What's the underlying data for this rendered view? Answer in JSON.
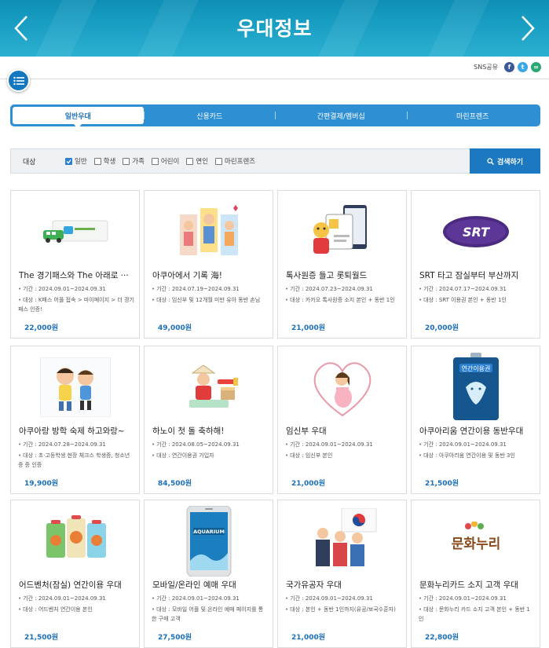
{
  "header": {
    "title": "우대정보"
  },
  "sns": {
    "label": "SNS공유"
  },
  "tabs": [
    {
      "label": "일반우대",
      "active": true
    },
    {
      "label": "신용카드",
      "active": false
    },
    {
      "label": "간편결제/멤버십",
      "active": false
    },
    {
      "label": "마린프렌즈",
      "active": false
    }
  ],
  "filter": {
    "label": "대상",
    "options": [
      {
        "label": "일반",
        "checked": true
      },
      {
        "label": "학생",
        "checked": false
      },
      {
        "label": "가족",
        "checked": false
      },
      {
        "label": "어린이",
        "checked": false
      },
      {
        "label": "연인",
        "checked": false
      },
      {
        "label": "마린프렌즈",
        "checked": false
      }
    ],
    "search_label": "검색하기"
  },
  "cards": [
    {
      "title": "The 경기패스와 The 아래로 ···",
      "period": "기간 : 2024.09.01~2024.09.31",
      "target": "대상 : K패스 어플 접속 > 마이페이지 > 더 경기패스 인증!",
      "price": "22,000원",
      "icon": "gyeonggi-pass-card-icon"
    },
    {
      "title": "아쿠아에서 기록 海!",
      "period": "기간 : 2024.07.19~2024.09.31",
      "target": "대상 : 임신부 및 12개월 미만 유아 동반 손님",
      "price": "49,000원",
      "icon": "family-record-icon"
    },
    {
      "title": "톡사원증 들고 롯퇴월드",
      "period": "기간 : 2024.07.23~2024.09.31",
      "target": "대상 : 카카오 톡사원증 소지 본인 + 동반 1인",
      "price": "21,000원",
      "icon": "employee-id-card-icon"
    },
    {
      "title": "SRT 타고 잠실부터 부산까지",
      "period": "기간 : 2024.07.17~2024.09.31",
      "target": "대상 : SRT 이용권 본인 + 동반 1인",
      "price": "20,000원",
      "icon": "srt-logo-icon"
    },
    {
      "title": "아쿠아랑 방학 숙제 하고와랑~",
      "period": "기간 : 2024.07.28~2024.09.31",
      "target": "대상 : 초·고등학생 현장 체크스 학생증, 청소년증 증 인증",
      "price": "19,900원",
      "icon": "kids-homework-icon"
    },
    {
      "title": "하노이 첫 돌 축하해!",
      "period": "기간 : 2024.08.05~2024.09.31",
      "target": "대상 : 연간이용권 가입자",
      "price": "84,500원",
      "icon": "first-birthday-icon"
    },
    {
      "title": "임신부 우대",
      "period": "기간 : 2024.09.01~2024.09.31",
      "target": "대상 : 임신부 본인",
      "price": "21,000원",
      "icon": "pregnant-woman-icon"
    },
    {
      "title": "아쿠아리움 연간이용 동반우대",
      "period": "기간 : 2024.09.01~2024.09.31",
      "target": "대상 : 아쿠아리움 연간이용 및 동반 3인",
      "price": "21,500원",
      "icon": "annual-pass-icon"
    },
    {
      "title": "어드벤처(잠실) 연간이용 우대",
      "period": "기간 : 2024.09.01~2024.09.31",
      "target": "대상 : 어드벤처 연간이용 본인",
      "price": "21,500원",
      "icon": "adventure-pass-icon"
    },
    {
      "title": "모바일/온라인 예매 우대",
      "period": "기간 : 2024.09.01~2024.09.31",
      "target": "대상 : 모바일 어플 및 온라인 예매 페이지를 통한 구매 고객",
      "price": "27,500원",
      "icon": "mobile-booking-icon"
    },
    {
      "title": "국가유공자 우대",
      "period": "기간 : 2024.09.01~2024.09.31",
      "target": "대상 : 본인 + 동반 1인까지(유공/보국수훈자)",
      "price": "21,000원",
      "icon": "national-merit-icon"
    },
    {
      "title": "문화누리카드 소지 고객 우대",
      "period": "기간 : 2024.09.01~2024.09.31",
      "target": "대상 : 문화누리 카드 소지 고객 본인 + 동반 1인",
      "price": "22,800원",
      "icon": "culture-card-logo-icon"
    }
  ],
  "colors": {
    "header": "#1a9fc4",
    "accent": "#1c78c0",
    "price": "#1a6fb9"
  }
}
